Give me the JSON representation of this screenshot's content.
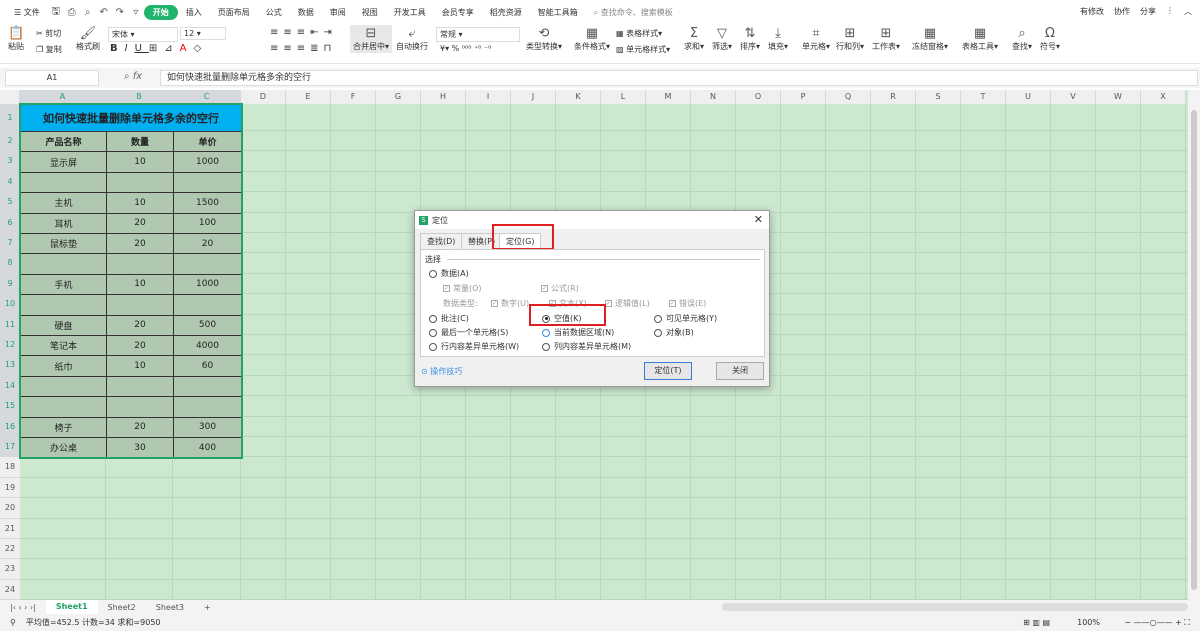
{
  "menubar": {
    "file": "文件",
    "tabs": [
      "开始",
      "插入",
      "页面布局",
      "公式",
      "数据",
      "审阅",
      "视图",
      "开发工具",
      "会员专享",
      "稻壳资源",
      "智能工具箱"
    ],
    "search": "查找命令、搜索模板",
    "right": [
      "有修改",
      "协作",
      "分享"
    ]
  },
  "ribbon": {
    "paste": "粘贴",
    "cut": "剪切",
    "copy": "复制",
    "format_painter": "格式刷",
    "font": "宋体",
    "size": "12",
    "merge": "合并居中",
    "wrap": "自动换行",
    "number_format": "常规",
    "convert": "类型转换",
    "cond_format": "条件格式",
    "table_style": "表格样式",
    "cell_style": "单元格样式",
    "sum": "求和",
    "filter": "筛选",
    "sort": "排序",
    "fill": "填充",
    "cell": "单元格",
    "rowcol": "行和列",
    "sheet": "工作表",
    "freeze": "冻结窗格",
    "tools": "表格工具",
    "find": "查找",
    "symbol": "符号"
  },
  "formula_bar": {
    "name_box": "A1",
    "fx": "fx",
    "formula": "如何快速批量删除单元格多余的空行"
  },
  "columns": [
    "A",
    "B",
    "C",
    "D",
    "E",
    "F",
    "G",
    "H",
    "I",
    "J",
    "K",
    "L",
    "M",
    "N",
    "O",
    "P",
    "Q",
    "R",
    "S",
    "T",
    "U",
    "V",
    "W",
    "X"
  ],
  "rows": [
    "1",
    "2",
    "3",
    "4",
    "5",
    "6",
    "7",
    "8",
    "9",
    "10",
    "11",
    "12",
    "13",
    "14",
    "15",
    "16",
    "17",
    "18",
    "19",
    "20",
    "21",
    "22",
    "23",
    "24"
  ],
  "table": {
    "title": "如何快速批量删除单元格多余的空行",
    "headers": [
      "产品名称",
      "数量",
      "单价"
    ],
    "rows": [
      [
        "显示屏",
        "10",
        "1000"
      ],
      [
        "",
        "",
        ""
      ],
      [
        "主机",
        "10",
        "1500"
      ],
      [
        "耳机",
        "20",
        "100"
      ],
      [
        "鼠标垫",
        "20",
        "20"
      ],
      [
        "",
        "",
        ""
      ],
      [
        "手机",
        "10",
        "1000"
      ],
      [
        "",
        "",
        ""
      ],
      [
        "硬盘",
        "20",
        "500"
      ],
      [
        "笔记本",
        "20",
        "4000"
      ],
      [
        "纸巾",
        "10",
        "60"
      ],
      [
        "",
        "",
        ""
      ],
      [
        "",
        "",
        ""
      ],
      [
        "椅子",
        "20",
        "300"
      ],
      [
        "办公桌",
        "30",
        "400"
      ]
    ]
  },
  "sheets": [
    "Sheet1",
    "Sheet2",
    "Sheet3"
  ],
  "status": {
    "text": "平均值=452.5  计数=34  求和=9050",
    "zoom": "100%"
  },
  "dialog": {
    "title": "定位",
    "tabs": [
      "查找(D)",
      "替换(P)",
      "定位(G)"
    ],
    "section": "选择",
    "data": "数据(A)",
    "constants": "常量(O)",
    "formulas": "公式(R)",
    "data_type": "数据类型:",
    "number": "数字(U)",
    "text": "文本(X)",
    "logical": "逻辑值(L)",
    "error": "错误(E)",
    "options": [
      "批注(C)",
      "空值(K)",
      "可见单元格(Y)",
      "最后一个单元格(S)",
      "当前数据区域(N)",
      "对象(B)",
      "行内容差异单元格(W)",
      "列内容差异单元格(M)"
    ],
    "tips": "操作技巧",
    "ok": "定位(T)",
    "close": "关闭",
    "selected": "空值(K)"
  },
  "colors": {
    "accent": "#1fb36b",
    "sheet_bg": "#cce8cf",
    "title_fill": "#00b0f0",
    "cell_fill": "#b0c8b0",
    "highlight": "#e02020"
  }
}
